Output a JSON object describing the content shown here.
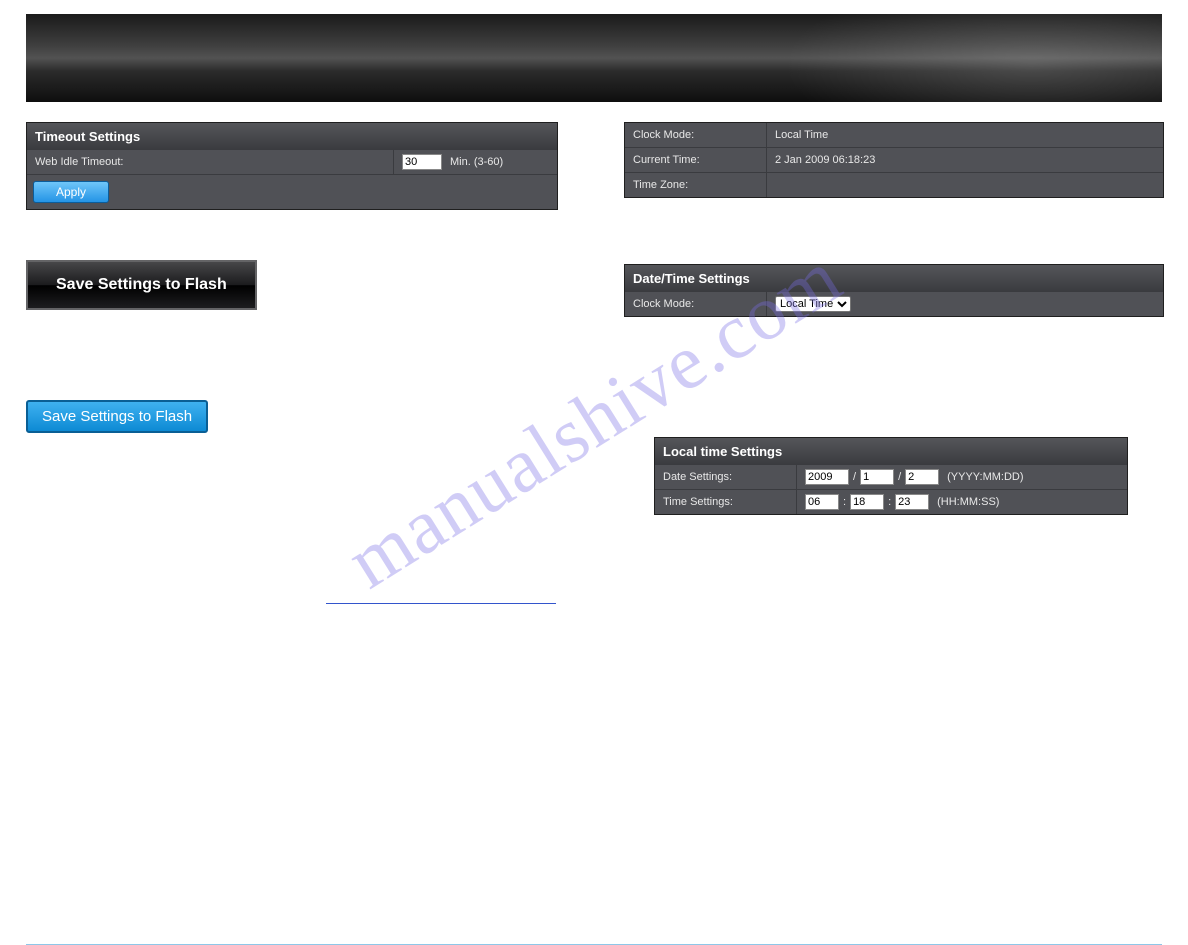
{
  "timeout": {
    "header": "Timeout Settings",
    "label": "Web Idle Timeout:",
    "value": "30",
    "hint": "Min. (3-60)",
    "apply": "Apply"
  },
  "black_button": "Save Settings to Flash",
  "blue_button": "Save Settings to Flash",
  "status": {
    "clock_mode_label": "Clock Mode:",
    "clock_mode_value": "Local Time",
    "current_time_label": "Current Time:",
    "current_time_value": "2 Jan 2009 06:18:23",
    "time_zone_label": "Time Zone:",
    "time_zone_value": ""
  },
  "datetime": {
    "header": "Date/Time Settings",
    "clock_mode_label": "Clock Mode:",
    "clock_mode_selected": "Local Time"
  },
  "localtime": {
    "header": "Local time Settings",
    "date_label": "Date Settings:",
    "date_year": "2009",
    "date_month": "1",
    "date_day": "2",
    "date_hint": "(YYYY:MM:DD)",
    "time_label": "Time Settings:",
    "time_hh": "06",
    "time_mm": "18",
    "time_ss": "23",
    "time_hint": "(HH:MM:SS)"
  },
  "watermark": "manualshive.com"
}
